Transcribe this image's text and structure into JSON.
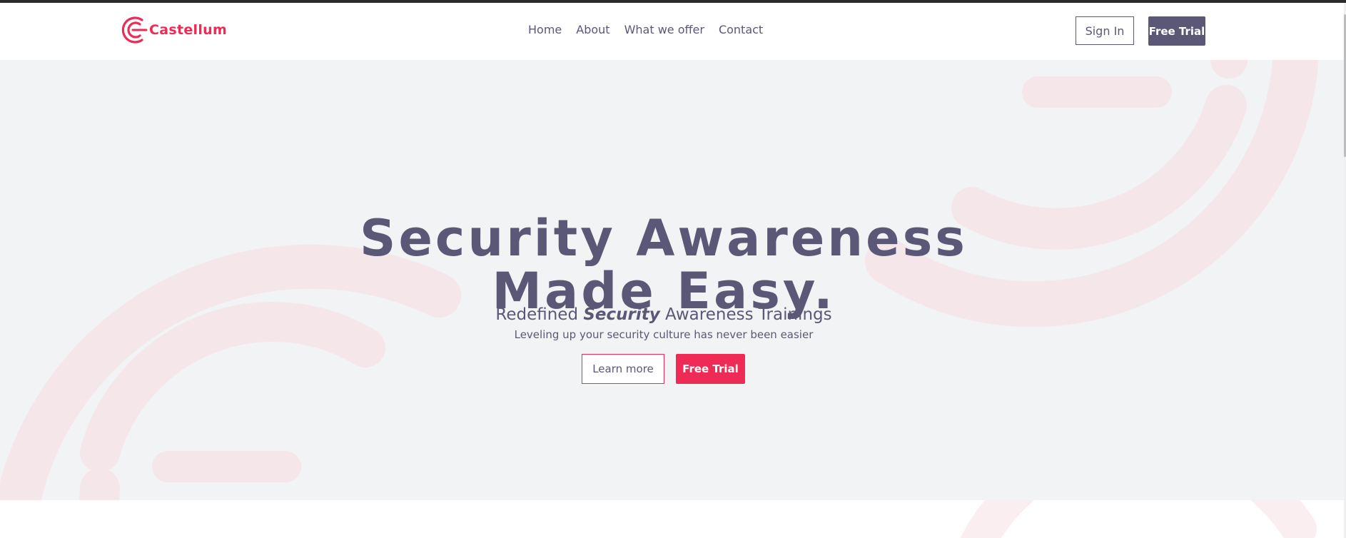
{
  "brand": {
    "name": "Castellum",
    "color": "#ee2a55",
    "icon": "castellum-logo-icon"
  },
  "nav": {
    "items": [
      {
        "label": "Home"
      },
      {
        "label": "About"
      },
      {
        "label": "What we offer"
      },
      {
        "label": "Contact"
      }
    ],
    "sign_in_label": "Sign In",
    "free_trial_label": "Free Trial"
  },
  "hero": {
    "title_line1": "Security Awareness",
    "title_line2": "Made Easy.",
    "subtitle_prefix": "Redefined ",
    "subtitle_emphasis": "Security",
    "subtitle_suffix": " Awareness Trainings",
    "description": "Leveling up your security culture has never been easier",
    "learn_more_label": "Learn more",
    "free_trial_label": "Free Trial"
  },
  "colors": {
    "primary": "#5a5876",
    "accent": "#ee2a55",
    "hero_background": "#f2f3f5",
    "decor": "#f5e6ea"
  }
}
